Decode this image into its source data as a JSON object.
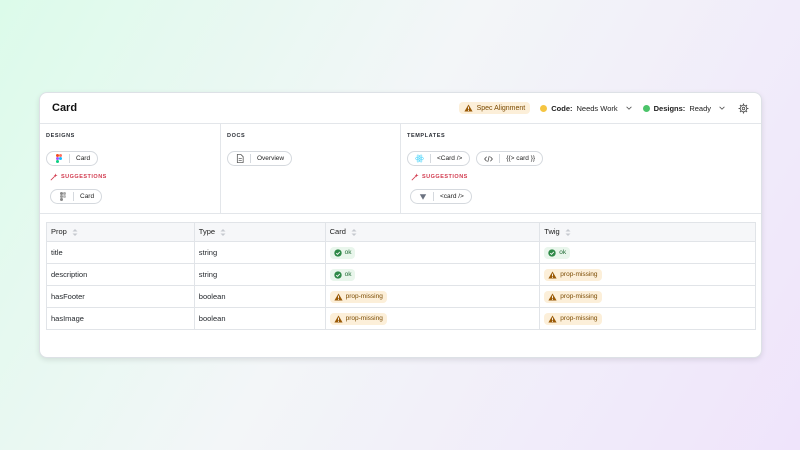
{
  "card": {
    "title": "Card",
    "spec_alignment_label": "Spec Alignment",
    "code_status": {
      "label": "Code:",
      "value": "Needs Work",
      "color": "#f5c542"
    },
    "designs_status": {
      "label": "Designs:",
      "value": "Ready",
      "color": "#4cc46a"
    }
  },
  "sections": {
    "designs": {
      "label": "DESIGNS",
      "chip": "Card",
      "suggestions_label": "SUGGESTIONS",
      "suggestion_chip": "Card"
    },
    "docs": {
      "label": "DOCS",
      "chip": "Overview"
    },
    "templates": {
      "label": "TEMPLATES",
      "chips": [
        "<Card />",
        "{{> card }}"
      ],
      "suggestions_label": "SUGGESTIONS",
      "suggestion_chip": "<card />"
    }
  },
  "table": {
    "headers": [
      "Prop",
      "Type",
      "Card",
      "Twig"
    ],
    "rows": [
      {
        "prop": "title",
        "type": "string",
        "card": "ok",
        "twig": "ok"
      },
      {
        "prop": "description",
        "type": "string",
        "card": "ok",
        "twig": "prop-missing"
      },
      {
        "prop": "hasFooter",
        "type": "boolean",
        "card": "prop-missing",
        "twig": "prop-missing"
      },
      {
        "prop": "hasImage",
        "type": "boolean",
        "card": "prop-missing",
        "twig": "prop-missing"
      }
    ]
  },
  "colors": {
    "ok": "#2f8a48",
    "warn": "#a5670a",
    "suggest": "#d23b4f"
  }
}
